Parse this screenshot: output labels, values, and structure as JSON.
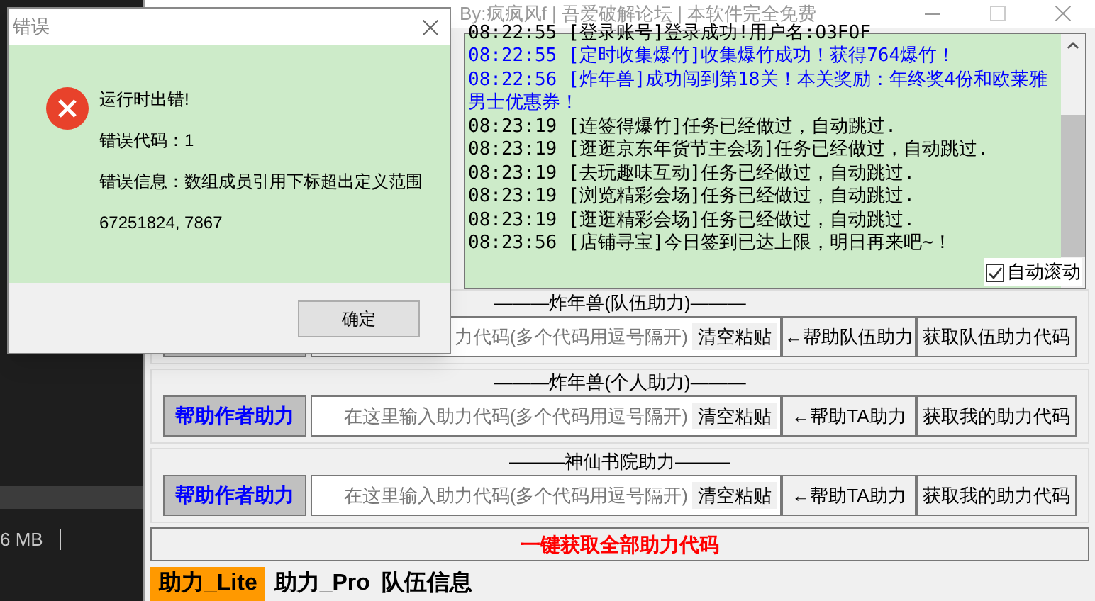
{
  "background_app": {
    "status_text": "6 MB"
  },
  "window": {
    "title": "By:疯疯风f | 吾爱破解论坛 | 本软件完全免费"
  },
  "log": {
    "lines": [
      {
        "time": "08:22:55",
        "text": "[登录账号]登录成功!用户名:O3FOF",
        "color": "#000000"
      },
      {
        "time": "08:22:55",
        "text": "[定时收集爆竹]收集爆竹成功！获得764爆竹！",
        "color": "#0000ff"
      },
      {
        "time": "08:22:56",
        "text": "[炸年兽]成功闯到第18关！本关奖励：年终奖4份和欧莱雅男士优惠券！",
        "color": "#0000ff"
      },
      {
        "time": "08:23:19",
        "text": "[连签得爆竹]任务已经做过，自动跳过.",
        "color": "#000000"
      },
      {
        "time": "08:23:19",
        "text": "[逛逛京东年货节主会场]任务已经做过，自动跳过.",
        "color": "#000000"
      },
      {
        "time": "08:23:19",
        "text": "[去玩趣味互动]任务已经做过，自动跳过.",
        "color": "#000000"
      },
      {
        "time": "08:23:19",
        "text": "[浏览精彩会场]任务已经做过，自动跳过.",
        "color": "#000000"
      },
      {
        "time": "08:23:19",
        "text": "[逛逛精彩会场]任务已经做过，自动跳过.",
        "color": "#000000"
      },
      {
        "time": "08:23:56",
        "text": "[店铺寻宝]今日签到已达上限，明日再来吧~！",
        "color": "#000000"
      }
    ],
    "auto_scroll": {
      "label": "自动滚动",
      "checked": true
    }
  },
  "sections": [
    {
      "title": "———炸年兽(队伍助力)———",
      "input_placeholder": "力代码(多个代码用逗号隔开)",
      "clear_button": "清空粘贴",
      "help_button": "←帮助队伍助力",
      "get_button": "获取队伍助力代码"
    },
    {
      "title": "———炸年兽(个人助力)———",
      "author_button": "帮助作者助力",
      "input_placeholder": "在这里输入助力代码(多个代码用逗号隔开)",
      "clear_button": "清空粘贴",
      "help_button": "←帮助TA助力",
      "get_button": "获取我的助力代码"
    },
    {
      "title": "———神仙书院助力———",
      "author_button": "帮助作者助力",
      "input_placeholder": "在这里输入助力代码(多个代码用逗号隔开)",
      "clear_button": "清空粘贴",
      "help_button": "←帮助TA助力",
      "get_button": "获取我的助力代码"
    }
  ],
  "get_all_button": "一键获取全部助力代码",
  "tabs": [
    {
      "label": "助力_Lite",
      "selected": true
    },
    {
      "label": "助力_Pro",
      "selected": false
    },
    {
      "label": "队伍信息",
      "selected": false
    }
  ],
  "dialog": {
    "title": "错误",
    "message_lines": [
      "运行时出错!",
      "错误代码：1",
      "错误信息：数组成员引用下标超出定义范围",
      "67251824, 7867"
    ],
    "ok_button": "确定"
  }
}
